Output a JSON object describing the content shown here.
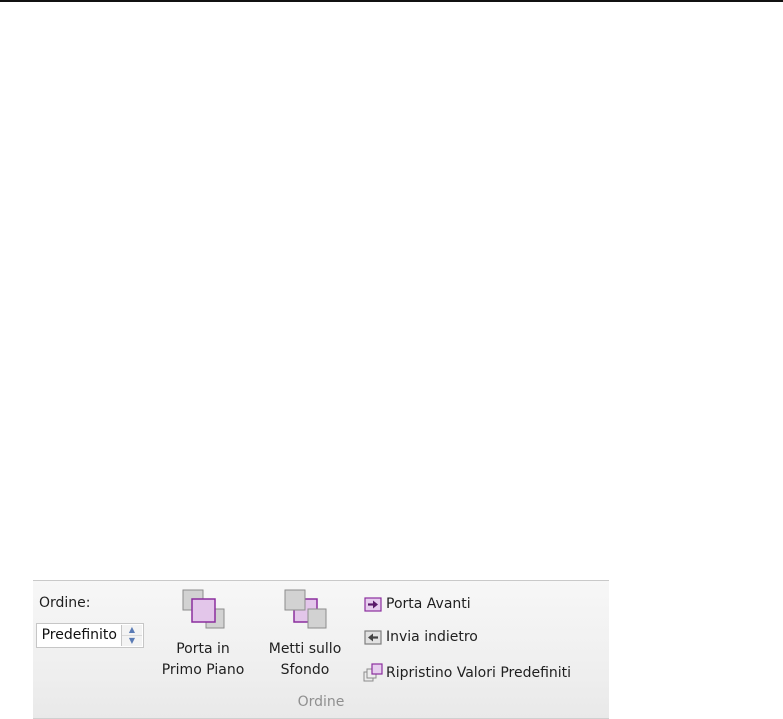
{
  "order_group": {
    "label": "Ordine:",
    "spin_value": "Predefinito",
    "group_label": "Ordine"
  },
  "buttons": {
    "bring_front": {
      "line1": "Porta in",
      "line2": "Primo Piano",
      "icon": "bring-to-front-icon"
    },
    "send_back": {
      "line1": "Metti sullo",
      "line2": "Sfondo",
      "icon": "send-to-back-icon"
    },
    "bring_forward": {
      "label": "Porta Avanti",
      "icon": "bring-forward-icon"
    },
    "send_backward": {
      "label": "Invia indietro",
      "icon": "send-backward-icon"
    },
    "reset_default": {
      "label": "Ripristino Valori Predefiniti",
      "icon": "reset-order-icon"
    }
  },
  "colors": {
    "accent": "#8b2e9e",
    "group_label": "#8f8f8f"
  }
}
